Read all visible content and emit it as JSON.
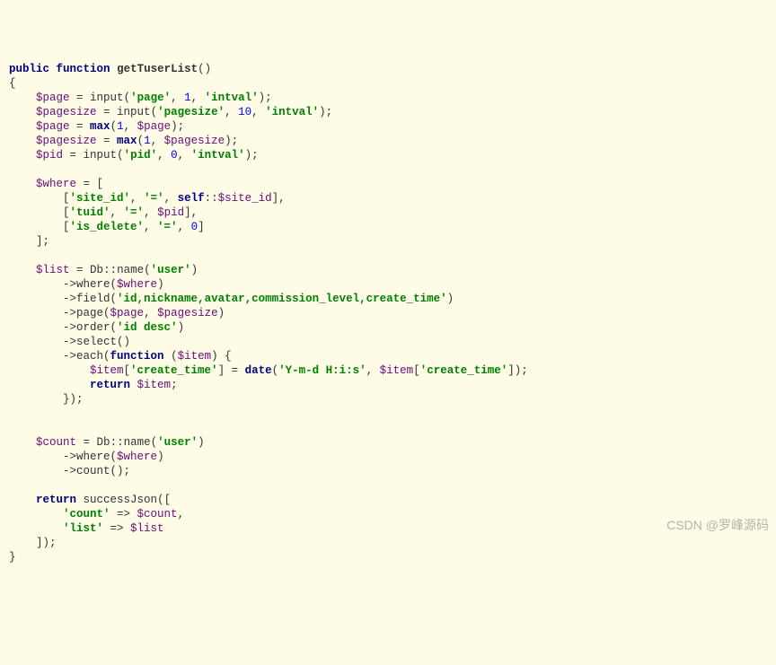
{
  "code": {
    "l1": {
      "kw1": "public",
      "kw2": "function",
      "name": "getTuserList"
    },
    "l3": {
      "var": "$page",
      "fn": "input",
      "s1": "'page'",
      "n1": "1",
      "s2": "'intval'"
    },
    "l4": {
      "var": "$pagesize",
      "fn": "input",
      "s1": "'pagesize'",
      "n1": "10",
      "s2": "'intval'"
    },
    "l5": {
      "var": "$page",
      "fn": "max",
      "n1": "1",
      "v2": "$page"
    },
    "l6": {
      "var": "$pagesize",
      "fn": "max",
      "n1": "1",
      "v2": "$pagesize"
    },
    "l7": {
      "var": "$pid",
      "fn": "input",
      "s1": "'pid'",
      "n1": "0",
      "s2": "'intval'"
    },
    "l9": {
      "var": "$where"
    },
    "l10": {
      "s1": "'site_id'",
      "s2": "'='",
      "kw": "self",
      "prop": "$site_id"
    },
    "l11": {
      "s1": "'tuid'",
      "s2": "'='",
      "v": "$pid"
    },
    "l12": {
      "s1": "'is_delete'",
      "s2": "'='",
      "n": "0"
    },
    "l15": {
      "var": "$list",
      "cls": "Db",
      "m": "name",
      "s1": "'user'"
    },
    "l16": {
      "m": "where",
      "v": "$where"
    },
    "l17": {
      "m": "field",
      "s1": "'id,nickname,avatar,commission_level,create_time'"
    },
    "l18": {
      "m": "page",
      "v1": "$page",
      "v2": "$pagesize"
    },
    "l19": {
      "m": "order",
      "s1": "'id desc'"
    },
    "l20": {
      "m": "select"
    },
    "l21": {
      "m": "each",
      "kw": "function",
      "v": "$item"
    },
    "l22": {
      "v": "$item",
      "s1": "'create_time'",
      "fn": "date",
      "s2": "'Y-m-d H:i:s'",
      "v2": "$item",
      "s3": "'create_time'"
    },
    "l23": {
      "kw": "return",
      "v": "$item"
    },
    "l27": {
      "var": "$count",
      "cls": "Db",
      "m": "name",
      "s1": "'user'"
    },
    "l28": {
      "m": "where",
      "v": "$where"
    },
    "l29": {
      "m": "count"
    },
    "l31": {
      "kw": "return",
      "fn": "successJson"
    },
    "l32": {
      "s1": "'count'",
      "v": "$count"
    },
    "l33": {
      "s1": "'list'",
      "v": "$list"
    }
  },
  "watermark": "CSDN @罗峰源码"
}
